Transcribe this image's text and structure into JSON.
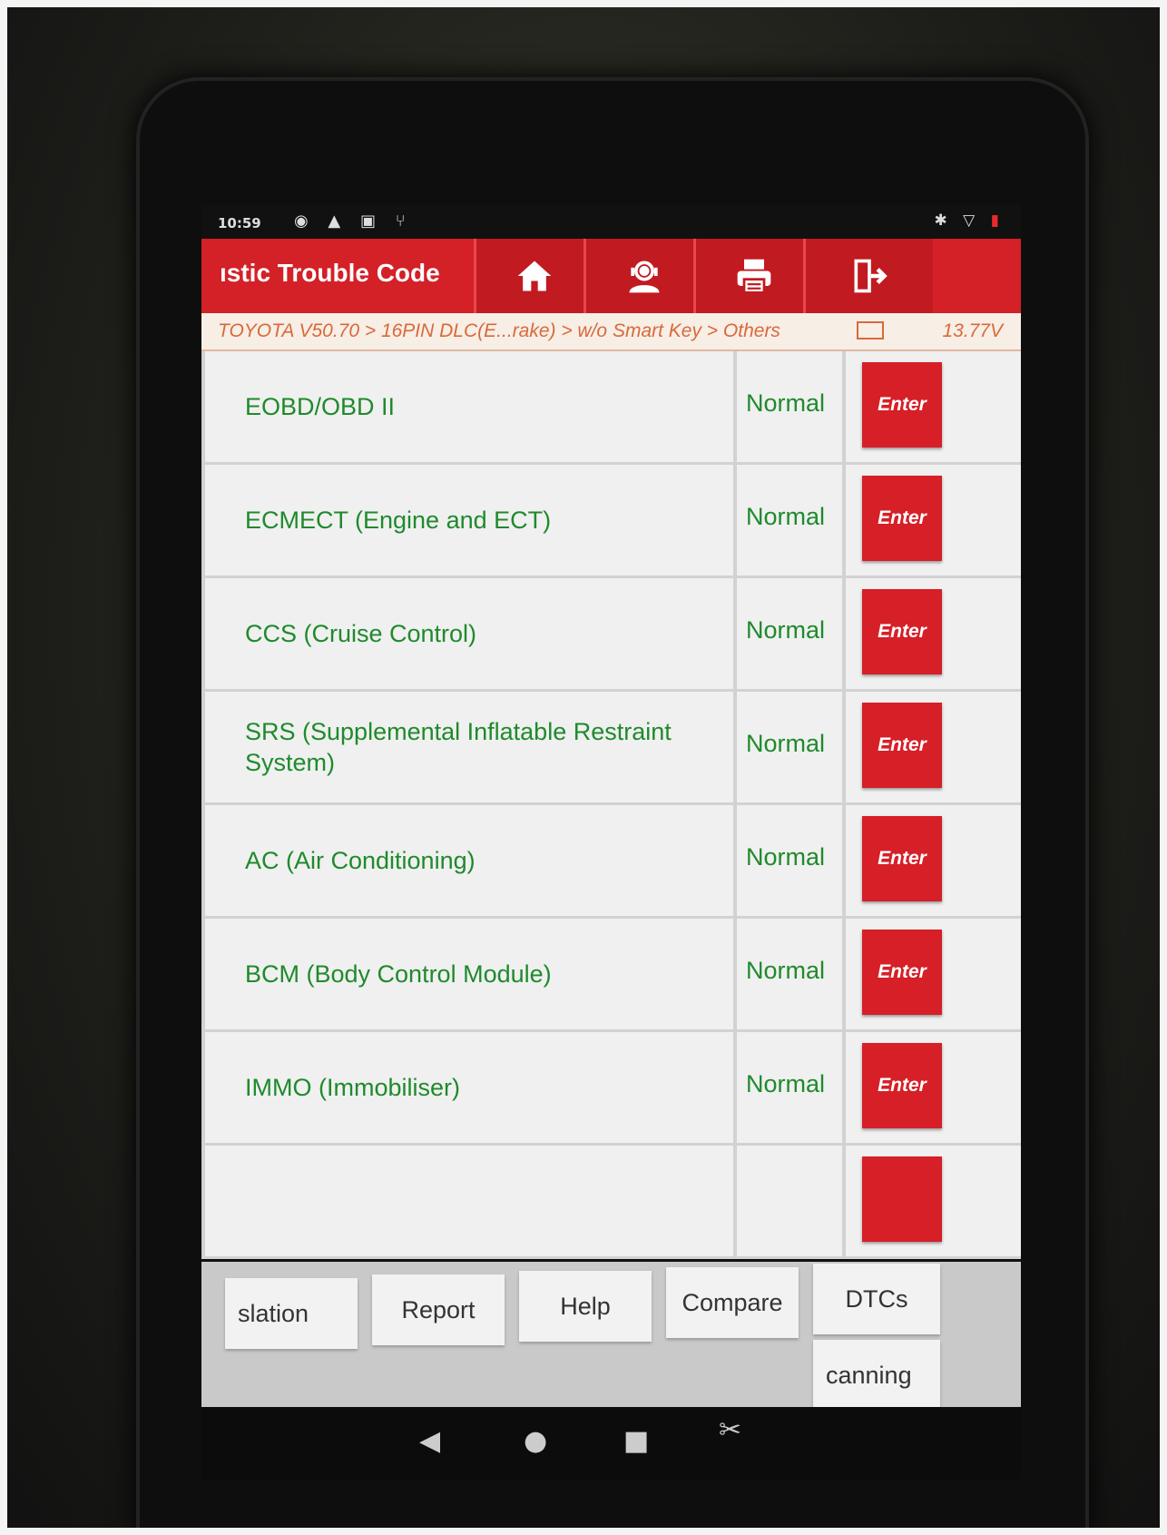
{
  "status_bar": {
    "time": "10:59",
    "left_icons": "◉ ▲ ▣ ⑂",
    "right_icons": "✱ ▽"
  },
  "header": {
    "title": "ıstic Trouble Code",
    "buttons": [
      {
        "name": "home-icon"
      },
      {
        "name": "support-agent-icon"
      },
      {
        "name": "print-icon"
      },
      {
        "name": "exit-icon"
      }
    ]
  },
  "breadcrumb": {
    "path": "TOYOTA V50.70 > 16PIN DLC(E...rake) > w/o Smart Key > Others",
    "voltage": "13.77V"
  },
  "systems": [
    {
      "name": "EOBD/OBD II",
      "status": "Normal",
      "action": "Enter"
    },
    {
      "name": "ECMECT (Engine and ECT)",
      "status": "Normal",
      "action": "Enter"
    },
    {
      "name": "CCS (Cruise Control)",
      "status": "Normal",
      "action": "Enter"
    },
    {
      "name": "SRS (Supplemental Inflatable Restraint System)",
      "status": "Normal",
      "action": "Enter"
    },
    {
      "name": "AC (Air Conditioning)",
      "status": "Normal",
      "action": "Enter"
    },
    {
      "name": "BCM (Body Control Module)",
      "status": "Normal",
      "action": "Enter"
    },
    {
      "name": "IMMO (Immobiliser)",
      "status": "Normal",
      "action": "Enter"
    },
    {
      "name": "",
      "status": "",
      "action": ""
    }
  ],
  "toolbar": {
    "translation": "slation",
    "report": "Report",
    "help": "Help",
    "compare": "Compare",
    "dtcs": "DTCs",
    "scanning": "canning"
  },
  "nav": {
    "back": "◀",
    "home": "●",
    "recents": "■",
    "screenshot": "✂"
  },
  "colors": {
    "header_red": "#d42027",
    "enter_red": "#d61f27",
    "system_green": "#1f8a2c",
    "breadcrumb_orange": "#d86a3a"
  }
}
